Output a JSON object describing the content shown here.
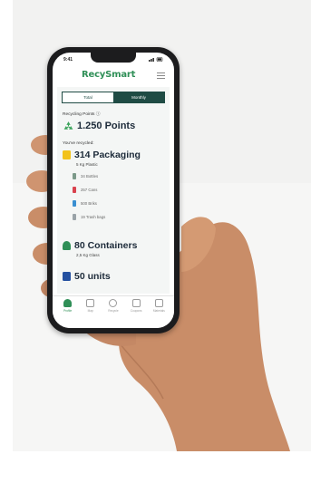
{
  "status_bar": {
    "time": "9:41"
  },
  "app": {
    "logo": "RecySmart"
  },
  "tabs": [
    {
      "label": "Total",
      "active": false
    },
    {
      "label": "Monthly",
      "active": true
    }
  ],
  "points": {
    "label": "Recycling Points ⓘ",
    "value": "1.250 Points",
    "icon": "recycle-icon"
  },
  "recycled": {
    "label": "You've recycled:",
    "categories": [
      {
        "title": "314 Packaging",
        "subtitle": "5 Kg Plastic",
        "color": "#f2c21b",
        "items": [
          {
            "label": "34 Bottles",
            "color": "#7c9a8a"
          },
          {
            "label": "257 Cans",
            "color": "#d9434e"
          },
          {
            "label": "500 Briks",
            "color": "#3a8fd1"
          },
          {
            "label": "19 Trash bags",
            "color": "#9aa3a8"
          }
        ]
      },
      {
        "title": "80 Containers",
        "subtitle": "2,5 Kg Glass",
        "color": "#2f8f57"
      },
      {
        "title": "50 units",
        "color": "#2450a0"
      }
    ]
  },
  "nav": [
    {
      "label": "Profile",
      "icon": "profile-icon",
      "active": true
    },
    {
      "label": "Map",
      "icon": "map-icon",
      "active": false
    },
    {
      "label": "Recycle",
      "icon": "recycle-nav-icon",
      "active": false
    },
    {
      "label": "Coupons",
      "icon": "coupon-icon",
      "active": false
    },
    {
      "label": "Materials",
      "icon": "materials-icon",
      "active": false
    }
  ],
  "colors": {
    "brand_green": "#2f8f57",
    "dark_teal": "#1f4b44"
  }
}
